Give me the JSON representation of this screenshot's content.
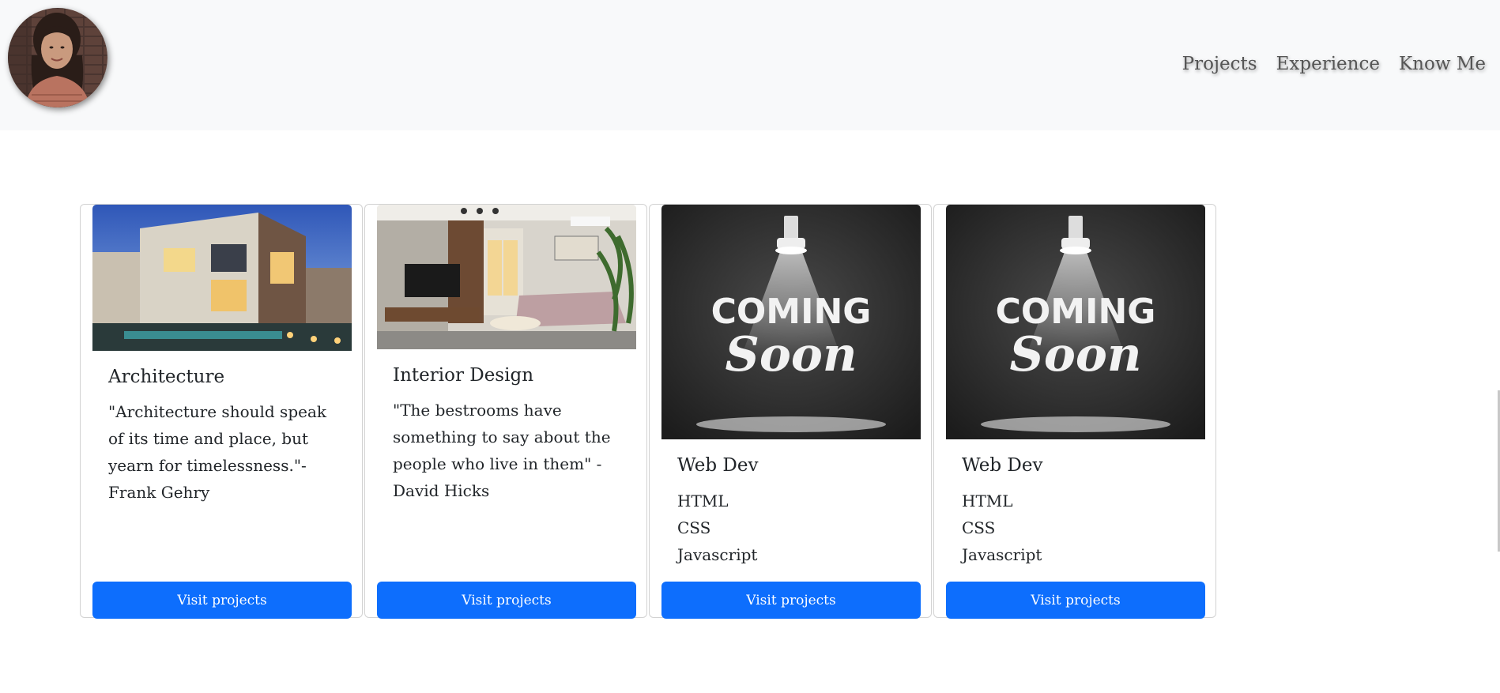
{
  "nav": {
    "avatar_alt": "Profile photo",
    "links": [
      "Projects",
      "Experience",
      "Know Me"
    ]
  },
  "cards": [
    {
      "title": "Architecture",
      "text": "\"Architecture should speak of its time and place, but yearn for timelessness.\"-Frank Gehry",
      "button": "Visit projects",
      "image": "modern-house-photo"
    },
    {
      "title": "Interior Design",
      "text": "\"The bestrooms have something to say about the people who live in them\" - David Hicks",
      "button": "Visit projects",
      "image": "living-room-photo"
    },
    {
      "title": "Web Dev",
      "list": [
        "HTML",
        "CSS",
        "Javascript"
      ],
      "button": "Visit projects",
      "image": "coming-soon-image",
      "image_text": [
        "COMING",
        "Soon"
      ]
    },
    {
      "title": "Web Dev",
      "list": [
        "HTML",
        "CSS",
        "Javascript"
      ],
      "button": "Visit projects",
      "image": "coming-soon-image",
      "image_text": [
        "COMING",
        "Soon"
      ]
    }
  ],
  "colors": {
    "navbar_bg": "#f8f9fa",
    "button_bg": "#0d6efd",
    "button_text": "#ffffff"
  }
}
